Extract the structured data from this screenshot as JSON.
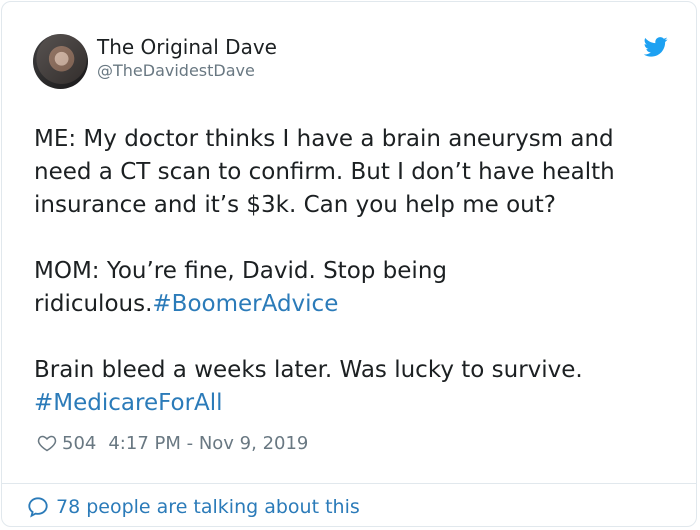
{
  "author": {
    "name": "The Original Dave",
    "handle": "@TheDavidestDave"
  },
  "tweet": {
    "paragraphs": [
      {
        "text": "ME: My doctor thinks I have a brain aneurysm and need a CT scan to confirm. But I don’t have health insurance and it’s $3k. Can you help me out?",
        "hashtag": ""
      },
      {
        "text": "MOM: You’re fine, David. Stop being ridiculous.",
        "hashtag": "#BoomerAdvice"
      },
      {
        "text": "Brain bleed a weeks later. Was lucky to survive. ",
        "hashtag": "#MedicareForAll"
      }
    ]
  },
  "meta": {
    "likes": "504",
    "timestamp": "4:17 PM - Nov 9, 2019"
  },
  "footer": {
    "talking": "78 people are talking about this"
  },
  "icons": {
    "brand": "twitter-bird-icon",
    "like": "heart-icon",
    "reply": "speech-bubble-icon"
  },
  "colors": {
    "link": "#2b7bb9",
    "bird": "#1da1f2",
    "muted": "#697882",
    "text": "#1c2022",
    "border": "#e1e8ed"
  }
}
